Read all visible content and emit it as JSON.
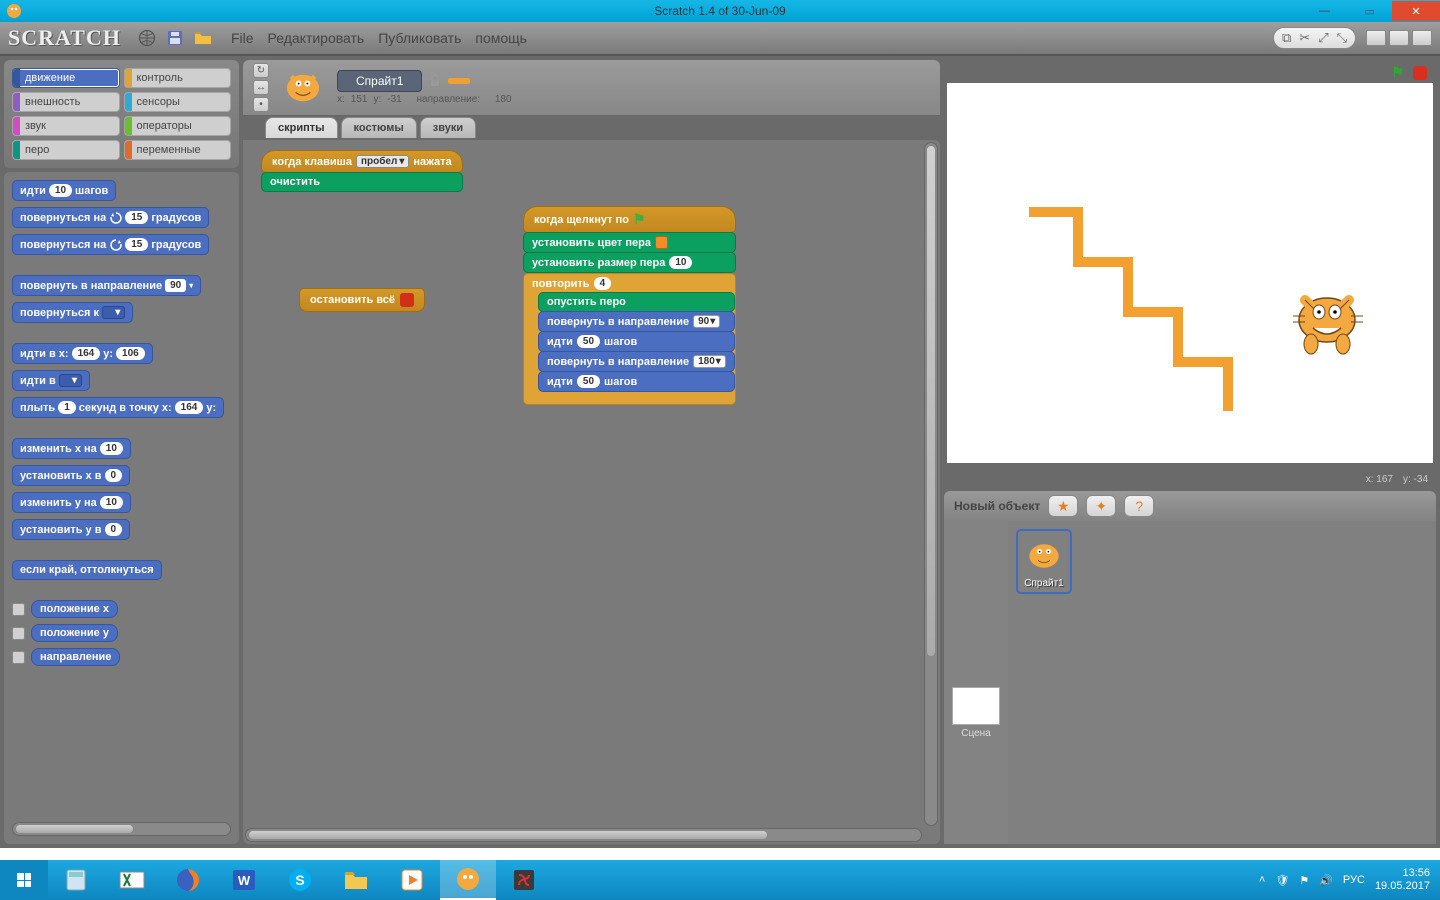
{
  "window": {
    "title": "Scratch 1.4 of 30-Jun-09"
  },
  "menu": {
    "file": "File",
    "edit": "Редактировать",
    "share": "Публиковать",
    "help": "помощь"
  },
  "categories": {
    "motion": {
      "label": "движение",
      "color": "#4c6ec0"
    },
    "control": {
      "label": "контроль",
      "color": "#e0a436"
    },
    "looks": {
      "label": "внешность",
      "color": "#915bc4"
    },
    "sensing": {
      "label": "сенсоры",
      "color": "#2eaad4"
    },
    "sound": {
      "label": "звук",
      "color": "#cf4fc2"
    },
    "operators": {
      "label": "операторы",
      "color": "#6bbe30"
    },
    "pen": {
      "label": "перо",
      "color": "#0d9684"
    },
    "variables": {
      "label": "переменные",
      "color": "#e06a2c"
    }
  },
  "palette": {
    "move": {
      "t1": "идти",
      "v": "10",
      "t2": "шагов"
    },
    "turn_cw": {
      "t1": "повернуться на",
      "v": "15",
      "t2": "градусов"
    },
    "turn_ccw": {
      "t1": "повернуться на",
      "v": "15",
      "t2": "градусов"
    },
    "point_dir": {
      "t1": "повернуть в направление",
      "v": "90"
    },
    "point_to": {
      "t1": "повернуться к"
    },
    "goto_xy": {
      "t1": "идти в x:",
      "x": "164",
      "t2": "y:",
      "y": "106"
    },
    "goto": {
      "t1": "идти в"
    },
    "glide": {
      "t1": "плыть",
      "s": "1",
      "t2": "секунд в точку x:",
      "x": "164",
      "t3": "y:"
    },
    "change_x": {
      "t1": "изменить x на",
      "v": "10"
    },
    "set_x": {
      "t1": "установить x в",
      "v": "0"
    },
    "change_y": {
      "t1": "изменить y на",
      "v": "10"
    },
    "set_y": {
      "t1": "установить y в",
      "v": "0"
    },
    "bounce": {
      "t1": "если край, оттолкнуться"
    },
    "rep_x": {
      "t1": "положение x"
    },
    "rep_y": {
      "t1": "положение y"
    },
    "rep_dir": {
      "t1": "направление"
    }
  },
  "sprite": {
    "name": "Спрайт1",
    "x_lbl": "x:",
    "x": "151",
    "y_lbl": "y:",
    "y": "-31",
    "dir_lbl": "направление:",
    "dir": "180"
  },
  "tabs": {
    "scripts": "скрипты",
    "costumes": "костюмы",
    "sounds": "звуки"
  },
  "scripts": {
    "s1": {
      "hat1": "когда клавиша",
      "hat2": "нажата",
      "key": "пробел",
      "clear": "очистить"
    },
    "s2": {
      "stopall": "остановить всё"
    },
    "s3": {
      "hat": "когда щелкнут по",
      "pencolor": "установить цвет пера",
      "pensize1": "установить размер пера",
      "pensize_v": "10",
      "repeat": "повторить",
      "repeat_n": "4",
      "pendown": "опустить перо",
      "point1": "повернуть в направление",
      "point1_v": "90",
      "move1a": "идти",
      "move1b": "шагов",
      "move1_v": "50",
      "point2": "повернуть в направление",
      "point2_v": "180",
      "move2a": "идти",
      "move2b": "шагов",
      "move2_v": "50"
    }
  },
  "stage": {
    "mouse_x_lbl": "x:",
    "mouse_x": "167",
    "mouse_y_lbl": "y:",
    "mouse_y": "-34"
  },
  "sprites": {
    "new_label": "Новый объект",
    "stage_label": "Сцена",
    "s1": "Спрайт1"
  },
  "taskbar": {
    "lang": "РУС",
    "time": "13:56",
    "date": "19.05.2017"
  }
}
